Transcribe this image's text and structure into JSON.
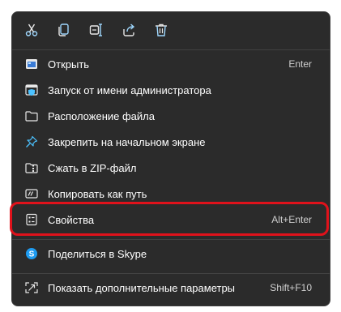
{
  "toolbar": {
    "buttons": [
      {
        "name": "cut",
        "icon": "scissors-icon"
      },
      {
        "name": "copy",
        "icon": "copy-icon"
      },
      {
        "name": "rename",
        "icon": "rename-icon"
      },
      {
        "name": "share",
        "icon": "share-icon"
      },
      {
        "name": "delete",
        "icon": "trash-icon"
      }
    ]
  },
  "menu": {
    "items": [
      {
        "label": "Открыть",
        "shortcut": "Enter",
        "icon": "app-window-icon"
      },
      {
        "label": "Запуск от имени администратора",
        "shortcut": "",
        "icon": "shield-window-icon"
      },
      {
        "label": "Расположение файла",
        "shortcut": "",
        "icon": "folder-icon"
      },
      {
        "label": "Закрепить на начальном экране",
        "shortcut": "",
        "icon": "pin-icon"
      },
      {
        "label": "Сжать в ZIP-файл",
        "shortcut": "",
        "icon": "zip-folder-icon"
      },
      {
        "label": "Копировать как путь",
        "shortcut": "",
        "icon": "path-icon"
      },
      {
        "label": "Свойства",
        "shortcut": "Alt+Enter",
        "icon": "properties-icon"
      },
      {
        "label": "Поделиться в Skype",
        "shortcut": "",
        "icon": "skype-icon"
      },
      {
        "label": "Показать дополнительные параметры",
        "shortcut": "Shift+F10",
        "icon": "more-options-icon"
      }
    ]
  },
  "colors": {
    "menu_background": "#2b2b2b",
    "text": "#ffffff",
    "highlight_border": "#e0121b",
    "accent": "#4cc2ff"
  }
}
